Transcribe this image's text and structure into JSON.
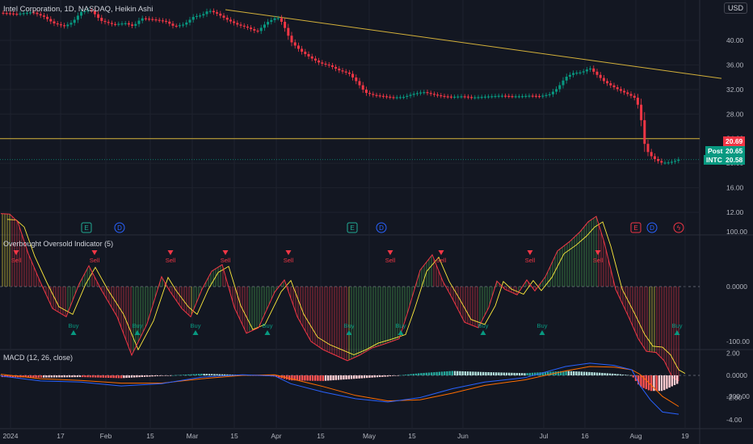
{
  "header": {
    "title": "Intel Corporation, 1D, NASDAQ, Heikin Ashi",
    "currency_button": "USD"
  },
  "price_axis": {
    "ticks": [
      "40.00",
      "36.00",
      "32.00",
      "28.00",
      "24.00",
      "20.00",
      "16.00",
      "12.00"
    ]
  },
  "osc_axis": {
    "ticks": [
      "100.00",
      "0.0000",
      "-100.00",
      "-200.00"
    ]
  },
  "macd_axis": {
    "ticks": [
      "2.00",
      "0.0000",
      "-2.00",
      "-4.00"
    ]
  },
  "time_axis": {
    "labels": [
      "2024",
      "17",
      "Feb",
      "15",
      "Mar",
      "15",
      "Apr",
      "15",
      "May",
      "15",
      "Jun",
      "Jul",
      "16",
      "Aug",
      "19"
    ]
  },
  "price_tags": {
    "last": "20.69",
    "post_label": "Post",
    "post_value": "20.65",
    "ticker_label": "INTC",
    "ticker_value": "20.58"
  },
  "osc_title": "Overbought Oversold Indicator (5)",
  "macd_title": "MACD (12, 26, close)",
  "signals": {
    "sell": "Sell",
    "buy": "Buy"
  },
  "event_markers": [
    {
      "letter": "E",
      "color": "#22ab94"
    },
    {
      "letter": "D",
      "color": "#2962ff"
    },
    {
      "letter": "E",
      "color": "#22ab94"
    },
    {
      "letter": "D",
      "color": "#2962ff"
    },
    {
      "letter": "E",
      "color": "#f23645"
    },
    {
      "letter": "D",
      "color": "#2962ff"
    },
    {
      "letter": "ϟ",
      "color": "#f23645"
    }
  ],
  "colors": {
    "background": "#131722",
    "grid": "#1e222d",
    "text": "#b2b5be",
    "up": "#089981",
    "down": "#f23645",
    "neutral": "#ffeb3b",
    "trendline": "#d4b13a",
    "macd_line": "#2962ff",
    "signal_line": "#ff6d00",
    "hist_pos_strong": "#26a69a",
    "hist_pos_weak": "#b2dfdb",
    "hist_neg_strong": "#ff5252",
    "hist_neg_weak": "#ffcdd2",
    "osc_fast": "#f23645",
    "osc_slow": "#ffeb3b",
    "osc_up_hatch": "#4caf50"
  },
  "chart_data": [
    {
      "type": "candlestick",
      "title": "Intel Corporation, 1D, NASDAQ, Heikin Ashi",
      "ylim": [
        9.5,
        45.5
      ],
      "x_labels": [
        "2024",
        "17",
        "Feb",
        "15",
        "Mar",
        "15",
        "Apr",
        "15",
        "May",
        "15",
        "Jun",
        "Jul",
        "16",
        "Aug",
        "19"
      ],
      "close_path": [
        [
          1,
          44.5
        ],
        [
          20,
          44.3
        ],
        [
          40,
          44.6
        ],
        [
          55,
          43.8
        ],
        [
          66,
          42.8
        ],
        [
          80,
          42.3
        ],
        [
          90,
          43.0
        ],
        [
          100,
          44.6
        ],
        [
          112,
          45.0
        ],
        [
          125,
          43.2
        ],
        [
          140,
          42.6
        ],
        [
          155,
          42.8
        ],
        [
          165,
          42.3
        ],
        [
          175,
          43.6
        ],
        [
          190,
          43.4
        ],
        [
          205,
          43.1
        ],
        [
          215,
          42.3
        ],
        [
          228,
          42.6
        ],
        [
          240,
          43.9
        ],
        [
          250,
          44.1
        ],
        [
          258,
          44.9
        ],
        [
          268,
          44.4
        ],
        [
          282,
          43.3
        ],
        [
          295,
          42.5
        ],
        [
          306,
          42.1
        ],
        [
          318,
          41.4
        ],
        [
          330,
          42.9
        ],
        [
          343,
          43.8
        ],
        [
          350,
          42.8
        ],
        [
          360,
          39.8
        ],
        [
          372,
          38.3
        ],
        [
          384,
          37.2
        ],
        [
          396,
          36.3
        ],
        [
          408,
          35.9
        ],
        [
          420,
          35.1
        ],
        [
          432,
          34.6
        ],
        [
          442,
          33.2
        ],
        [
          452,
          31.5
        ],
        [
          462,
          31.1
        ],
        [
          474,
          30.9
        ],
        [
          486,
          30.7
        ],
        [
          500,
          30.8
        ],
        [
          512,
          31.3
        ],
        [
          524,
          31.6
        ],
        [
          536,
          31.2
        ],
        [
          548,
          30.9
        ],
        [
          560,
          30.8
        ],
        [
          572,
          30.9
        ],
        [
          584,
          30.7
        ],
        [
          596,
          30.8
        ],
        [
          608,
          30.9
        ],
        [
          620,
          31.0
        ],
        [
          632,
          30.9
        ],
        [
          644,
          30.9
        ],
        [
          656,
          31.0
        ],
        [
          668,
          30.9
        ],
        [
          680,
          31.2
        ],
        [
          690,
          32.2
        ],
        [
          700,
          34.0
        ],
        [
          710,
          34.7
        ],
        [
          720,
          34.8
        ],
        [
          730,
          35.5
        ],
        [
          738,
          34.5
        ],
        [
          748,
          33.3
        ],
        [
          758,
          32.5
        ],
        [
          768,
          31.8
        ],
        [
          778,
          31.2
        ],
        [
          786,
          30.6
        ],
        [
          792,
          28.7
        ],
        [
          797,
          23.4
        ],
        [
          803,
          21.5
        ],
        [
          810,
          20.7
        ],
        [
          818,
          20.1
        ],
        [
          826,
          20.1
        ],
        [
          834,
          20.3
        ],
        [
          840,
          20.6
        ]
      ],
      "horizontal_levels": [
        24.0,
        20.58
      ],
      "trendline": {
        "from": [
          279,
          45.0
        ],
        "to": [
          893,
          33.8
        ]
      },
      "last_price": 20.69,
      "post_price": 20.65,
      "ticker_price": 20.58
    },
    {
      "type": "oscillator",
      "title": "Overbought Oversold Indicator (5)",
      "ylim": [
        -215,
        140
      ],
      "x_labels": [
        "2024",
        "17",
        "Feb",
        "15",
        "Mar",
        "15",
        "Apr",
        "15",
        "May",
        "15",
        "Jun",
        "Jul",
        "16",
        "Aug",
        "19"
      ],
      "series": [
        {
          "name": "fast",
          "path": [
            [
              1,
              133
            ],
            [
              12,
              132
            ],
            [
              22,
              118
            ],
            [
              35,
              60
            ],
            [
              50,
              8
            ],
            [
              65,
              -40
            ],
            [
              82,
              -55
            ],
            [
              98,
              5
            ],
            [
              110,
              38
            ],
            [
              125,
              -5
            ],
            [
              145,
              -55
            ],
            [
              163,
              -125
            ],
            [
              182,
              -68
            ],
            [
              200,
              18
            ],
            [
              210,
              -8
            ],
            [
              225,
              -40
            ],
            [
              236,
              -55
            ],
            [
              250,
              -5
            ],
            [
              262,
              28
            ],
            [
              275,
              40
            ],
            [
              290,
              -38
            ],
            [
              305,
              -85
            ],
            [
              320,
              -75
            ],
            [
              340,
              -10
            ],
            [
              352,
              12
            ],
            [
              368,
              -55
            ],
            [
              385,
              -100
            ],
            [
              400,
              -115
            ],
            [
              415,
              -125
            ],
            [
              430,
              -135
            ],
            [
              445,
              -125
            ],
            [
              460,
              -112
            ],
            [
              475,
              -105
            ],
            [
              494,
              -95
            ],
            [
              505,
              -45
            ],
            [
              520,
              30
            ],
            [
              535,
              58
            ],
            [
              548,
              10
            ],
            [
              560,
              -22
            ],
            [
              575,
              -65
            ],
            [
              592,
              -75
            ],
            [
              605,
              -38
            ],
            [
              615,
              10
            ],
            [
              625,
              -5
            ],
            [
              640,
              -15
            ],
            [
              652,
              12
            ],
            [
              662,
              -8
            ],
            [
              675,
              18
            ],
            [
              690,
              65
            ],
            [
              705,
              82
            ],
            [
              718,
              100
            ],
            [
              728,
              118
            ],
            [
              738,
              128
            ],
            [
              748,
              80
            ],
            [
              762,
              -5
            ],
            [
              778,
              -55
            ],
            [
              790,
              -95
            ],
            [
              800,
              -118
            ],
            [
              812,
              -120
            ],
            [
              822,
              -135
            ],
            [
              832,
              -165
            ],
            [
              840,
              -172
            ]
          ]
        }
      ],
      "signals": [
        {
          "x": 20,
          "label": "Sell"
        },
        {
          "x": 117,
          "label": "Sell"
        },
        {
          "x": 211,
          "label": "Sell"
        },
        {
          "x": 279,
          "label": "Sell"
        },
        {
          "x": 357,
          "label": "Sell"
        },
        {
          "x": 483,
          "label": "Sell"
        },
        {
          "x": 546,
          "label": "Sell"
        },
        {
          "x": 656,
          "label": "Sell"
        },
        {
          "x": 740,
          "label": "Sell"
        },
        {
          "x": 91,
          "label": "Buy"
        },
        {
          "x": 170,
          "label": "Buy"
        },
        {
          "x": 242,
          "label": "Buy"
        },
        {
          "x": 331,
          "label": "Buy"
        },
        {
          "x": 432,
          "label": "Buy"
        },
        {
          "x": 496,
          "label": "Buy"
        },
        {
          "x": 598,
          "label": "Buy"
        },
        {
          "x": 671,
          "label": "Buy"
        },
        {
          "x": 838,
          "label": "Buy"
        }
      ]
    },
    {
      "type": "macd",
      "title": "MACD (12, 26, close)",
      "ylim": [
        -4.3,
        2.3
      ],
      "x_labels": [
        "2024",
        "17",
        "Feb",
        "15",
        "Mar",
        "15",
        "Apr",
        "15",
        "May",
        "15",
        "Jun",
        "Jul",
        "16",
        "Aug",
        "19"
      ],
      "series": [
        {
          "name": "MACD",
          "path": [
            [
              1,
              -0.05
            ],
            [
              50,
              -0.5
            ],
            [
              100,
              -0.6
            ],
            [
              150,
              -0.95
            ],
            [
              200,
              -0.75
            ],
            [
              250,
              -0.15
            ],
            [
              300,
              0.05
            ],
            [
              340,
              -0.05
            ],
            [
              360,
              -0.75
            ],
            [
              400,
              -1.5
            ],
            [
              440,
              -2.1
            ],
            [
              480,
              -2.4
            ],
            [
              520,
              -2.0
            ],
            [
              560,
              -1.2
            ],
            [
              600,
              -0.6
            ],
            [
              650,
              -0.2
            ],
            [
              700,
              0.8
            ],
            [
              730,
              1.1
            ],
            [
              760,
              0.9
            ],
            [
              782,
              0.5
            ],
            [
              792,
              -0.9
            ],
            [
              805,
              -2.2
            ],
            [
              820,
              -3.3
            ],
            [
              840,
              -3.5
            ]
          ]
        },
        {
          "name": "Signal",
          "path": [
            [
              1,
              0.1
            ],
            [
              50,
              -0.3
            ],
            [
              100,
              -0.45
            ],
            [
              150,
              -0.7
            ],
            [
              200,
              -0.7
            ],
            [
              250,
              -0.3
            ],
            [
              300,
              0.0
            ],
            [
              340,
              0.05
            ],
            [
              360,
              -0.3
            ],
            [
              400,
              -1.0
            ],
            [
              440,
              -1.8
            ],
            [
              480,
              -2.3
            ],
            [
              520,
              -2.2
            ],
            [
              560,
              -1.6
            ],
            [
              600,
              -0.9
            ],
            [
              650,
              -0.4
            ],
            [
              700,
              0.4
            ],
            [
              730,
              0.8
            ],
            [
              760,
              0.75
            ],
            [
              782,
              0.5
            ],
            [
              792,
              0.1
            ],
            [
              805,
              -0.8
            ],
            [
              820,
              -1.9
            ],
            [
              840,
              -2.8
            ]
          ]
        }
      ]
    }
  ]
}
